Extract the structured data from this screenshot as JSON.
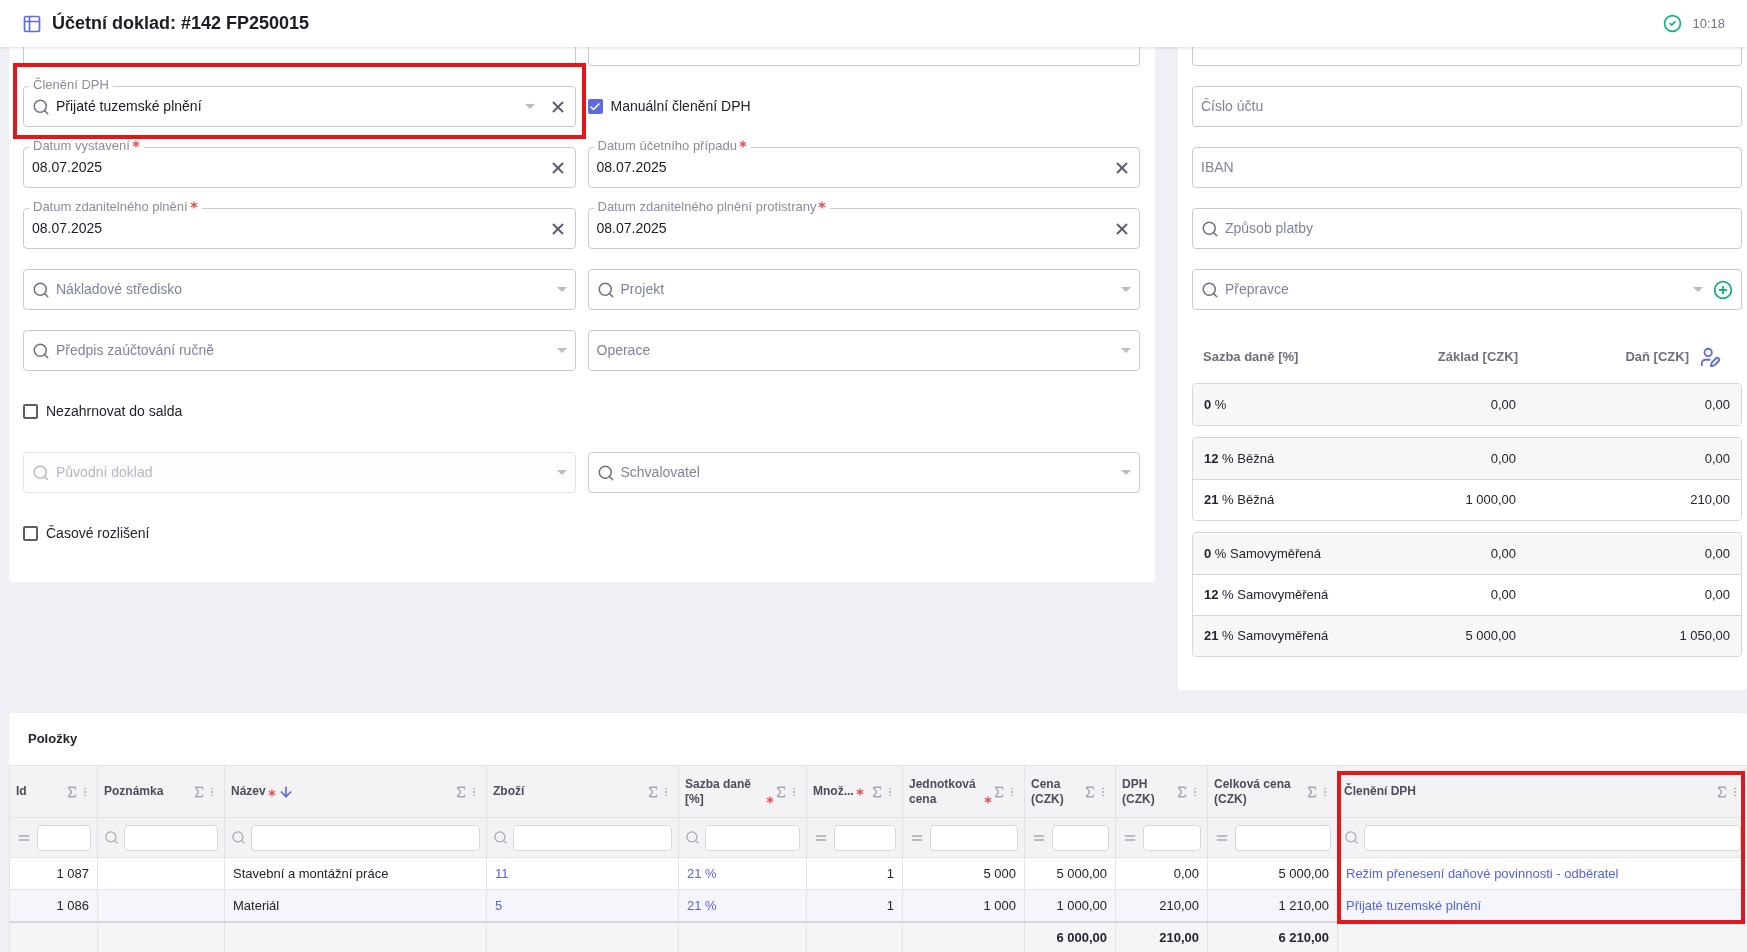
{
  "header": {
    "title": "Účetní doklad: #142 FP250015",
    "time": "10:18"
  },
  "form": {
    "rows": [
      [
        {
          "kind": "field",
          "label": "Členění DPH",
          "required": false,
          "value": "Přijaté tuzemské plnění",
          "search": true,
          "caret": true,
          "clear": true,
          "disabled": false,
          "highlighted": true
        },
        {
          "kind": "checkbox",
          "label": "Manuální členění DPH",
          "checked": true
        }
      ],
      [
        {
          "kind": "field",
          "label": "Datum vystavení",
          "required": true,
          "value": "08.07.2025",
          "search": false,
          "caret": false,
          "clear": true,
          "disabled": false
        },
        {
          "kind": "field",
          "label": "Datum účetního případu",
          "required": true,
          "value": "08.07.2025",
          "search": false,
          "caret": false,
          "clear": true,
          "disabled": false
        }
      ],
      [
        {
          "kind": "field",
          "label": "Datum zdanitelného plnění",
          "required": true,
          "value": "08.07.2025",
          "search": false,
          "caret": false,
          "clear": true,
          "disabled": false
        },
        {
          "kind": "field",
          "label": "Datum zdanitelného plnění protistrany",
          "required": true,
          "value": "08.07.2025",
          "search": false,
          "caret": false,
          "clear": true,
          "disabled": false
        }
      ],
      [
        {
          "kind": "field",
          "placeholder": "Nákladové středisko",
          "search": true,
          "caret": true,
          "clear": false,
          "disabled": false
        },
        {
          "kind": "field",
          "placeholder": "Projekt",
          "search": true,
          "caret": true,
          "clear": false,
          "disabled": false
        }
      ],
      [
        {
          "kind": "field",
          "placeholder": "Předpis zaúčtování ručně",
          "search": true,
          "caret": true,
          "clear": false,
          "disabled": false
        },
        {
          "kind": "field",
          "placeholder": "Operace",
          "search": false,
          "caret": true,
          "clear": false,
          "disabled": false
        }
      ],
      [
        {
          "kind": "checkbox",
          "label": "Nezahrnovat do salda",
          "checked": false
        }
      ],
      [
        {
          "kind": "field",
          "placeholder": "Původní doklad",
          "search": true,
          "caret": true,
          "clear": false,
          "disabled": true
        },
        {
          "kind": "field",
          "placeholder": "Schvalovatel",
          "search": true,
          "caret": true,
          "clear": false,
          "disabled": false
        }
      ],
      [
        {
          "kind": "checkbox",
          "label": "Časové rozlišení",
          "checked": false
        }
      ]
    ]
  },
  "payment": {
    "fields": [
      {
        "kind": "field",
        "placeholder": "Číslo účtu",
        "search": false,
        "caret": false,
        "clear": false,
        "disabled": false,
        "add": false
      },
      {
        "kind": "field",
        "placeholder": "IBAN",
        "search": false,
        "caret": false,
        "clear": false,
        "disabled": false,
        "add": false
      },
      {
        "kind": "field",
        "placeholder": "Způsob platby",
        "search": true,
        "caret": false,
        "clear": false,
        "disabled": false,
        "add": false
      },
      {
        "kind": "field",
        "placeholder": "Přepravce",
        "search": true,
        "caret": true,
        "clear": false,
        "disabled": false,
        "add": true
      }
    ]
  },
  "tax": {
    "columns": [
      "Sazba daně [%]",
      "Základ [CZK]",
      "Daň [CZK]"
    ],
    "groups": [
      [
        {
          "rate": "**0** %",
          "base": "0,00",
          "tax": "0,00"
        }
      ],
      [
        {
          "rate": "**12** % Běžná",
          "base": "0,00",
          "tax": "0,00"
        },
        {
          "rate": "**21** % Běžná",
          "base": "1 000,00",
          "tax": "210,00"
        }
      ],
      [
        {
          "rate": "**0** % Samovyměřená",
          "base": "0,00",
          "tax": "0,00"
        },
        {
          "rate": "**12** % Samovyměřená",
          "base": "0,00",
          "tax": "0,00"
        },
        {
          "rate": "**21** % Samovyměřená",
          "base": "5 000,00",
          "tax": "1 050,00"
        }
      ]
    ]
  },
  "items": {
    "title": "Položky",
    "columns": [
      {
        "label": "Id",
        "kind": "number",
        "required": false,
        "sorted": false,
        "searchable": false
      },
      {
        "label": "Poznámka",
        "kind": "text",
        "required": false,
        "sorted": false,
        "searchable": true
      },
      {
        "label": "Název",
        "kind": "text",
        "required": true,
        "sorted": true,
        "searchable": true
      },
      {
        "label": "Zboží",
        "kind": "link",
        "required": false,
        "sorted": false,
        "searchable": true
      },
      {
        "label": "Sazba daně [%]",
        "kind": "link",
        "required": true,
        "sorted": false,
        "searchable": true
      },
      {
        "label": "Množ...",
        "kind": "number",
        "required": true,
        "sorted": false,
        "searchable": false
      },
      {
        "label": "Jednotková cena",
        "kind": "number",
        "required": true,
        "sorted": false,
        "searchable": false
      },
      {
        "label": "Cena (CZK)",
        "kind": "number",
        "required": false,
        "sorted": false,
        "searchable": false,
        "total": "6 000,00"
      },
      {
        "label": "DPH (CZK)",
        "kind": "number",
        "required": false,
        "sorted": false,
        "searchable": false,
        "total": "210,00"
      },
      {
        "label": "Celková cena (CZK)",
        "kind": "number",
        "required": false,
        "sorted": false,
        "searchable": false,
        "total": "6 210,00"
      },
      {
        "label": "Členění DPH",
        "kind": "link",
        "required": false,
        "sorted": false,
        "searchable": true,
        "highlighted": true
      }
    ],
    "rows": [
      {
        "cells": [
          "1 087",
          null,
          "Stavební a montážní práce",
          "11",
          "21 %",
          "1",
          "5 000",
          "5 000,00",
          "0,00",
          "5 000,00",
          "Režim přenesení daňové povinnosti - odběratel"
        ]
      },
      {
        "cells": [
          "1 086",
          null,
          "Materiál",
          "5",
          "21 %",
          "1",
          "1 000",
          "1 000,00",
          "210,00",
          "1 210,00",
          "Přijaté tuzemské plnění"
        ]
      }
    ]
  }
}
